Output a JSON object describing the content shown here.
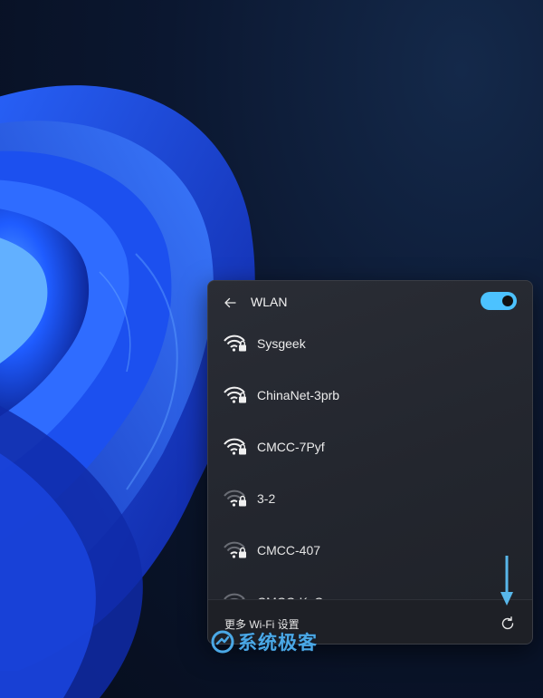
{
  "panel": {
    "title": "WLAN",
    "back_icon": "arrow-left-icon",
    "toggle_on": true,
    "accent_color": "#4cc2ff"
  },
  "networks": [
    {
      "name": "Sysgeek",
      "secured": true,
      "signal": "full"
    },
    {
      "name": "ChinaNet-3prb",
      "secured": true,
      "signal": "full"
    },
    {
      "name": "CMCC-7Pyf",
      "secured": true,
      "signal": "full"
    },
    {
      "name": "3-2",
      "secured": true,
      "signal": "weak"
    },
    {
      "name": "CMCC-407",
      "secured": true,
      "signal": "weak"
    },
    {
      "name": "CMCC-KxC",
      "secured": true,
      "signal": "weak"
    }
  ],
  "footer": {
    "settings_link": "更多 Wi-Fi 设置",
    "refresh_icon": "refresh-icon"
  },
  "watermark": {
    "text": "系统极客"
  }
}
